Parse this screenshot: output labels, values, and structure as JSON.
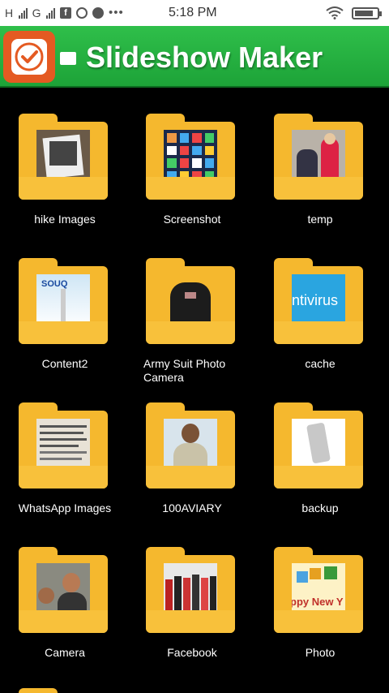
{
  "status_bar": {
    "left_text": "H",
    "carrier_g": "G",
    "time": "5:18 PM",
    "battery_level": 0.85
  },
  "header": {
    "title": "Slideshow Maker"
  },
  "colors": {
    "header_green": "#22b03e",
    "folder_yellow": "#f5b82e",
    "logo_orange": "#e45a22"
  },
  "folders": [
    {
      "label": "hike Images",
      "thumb": "photo-frame"
    },
    {
      "label": "Screenshot",
      "thumb": "phone-screen"
    },
    {
      "label": "temp",
      "thumb": "people-photo"
    },
    {
      "label": "Content2",
      "thumb": "souq-banner"
    },
    {
      "label": "Army Suit Photo Camera",
      "thumb": "army-suit"
    },
    {
      "label": "cache",
      "thumb": "antivirus-banner"
    },
    {
      "label": "WhatsApp Images",
      "thumb": "newspaper"
    },
    {
      "label": "100AVIARY",
      "thumb": "man-portrait"
    },
    {
      "label": "backup",
      "thumb": "phone-device"
    },
    {
      "label": "Camera",
      "thumb": "car-selfie"
    },
    {
      "label": "Facebook",
      "thumb": "group-photo"
    },
    {
      "label": "Photo",
      "thumb": "new-year-banner"
    }
  ],
  "thumb_text": {
    "souq": "SOUQ",
    "antivirus": "ntivirus",
    "new_year": "ppy New Y"
  }
}
